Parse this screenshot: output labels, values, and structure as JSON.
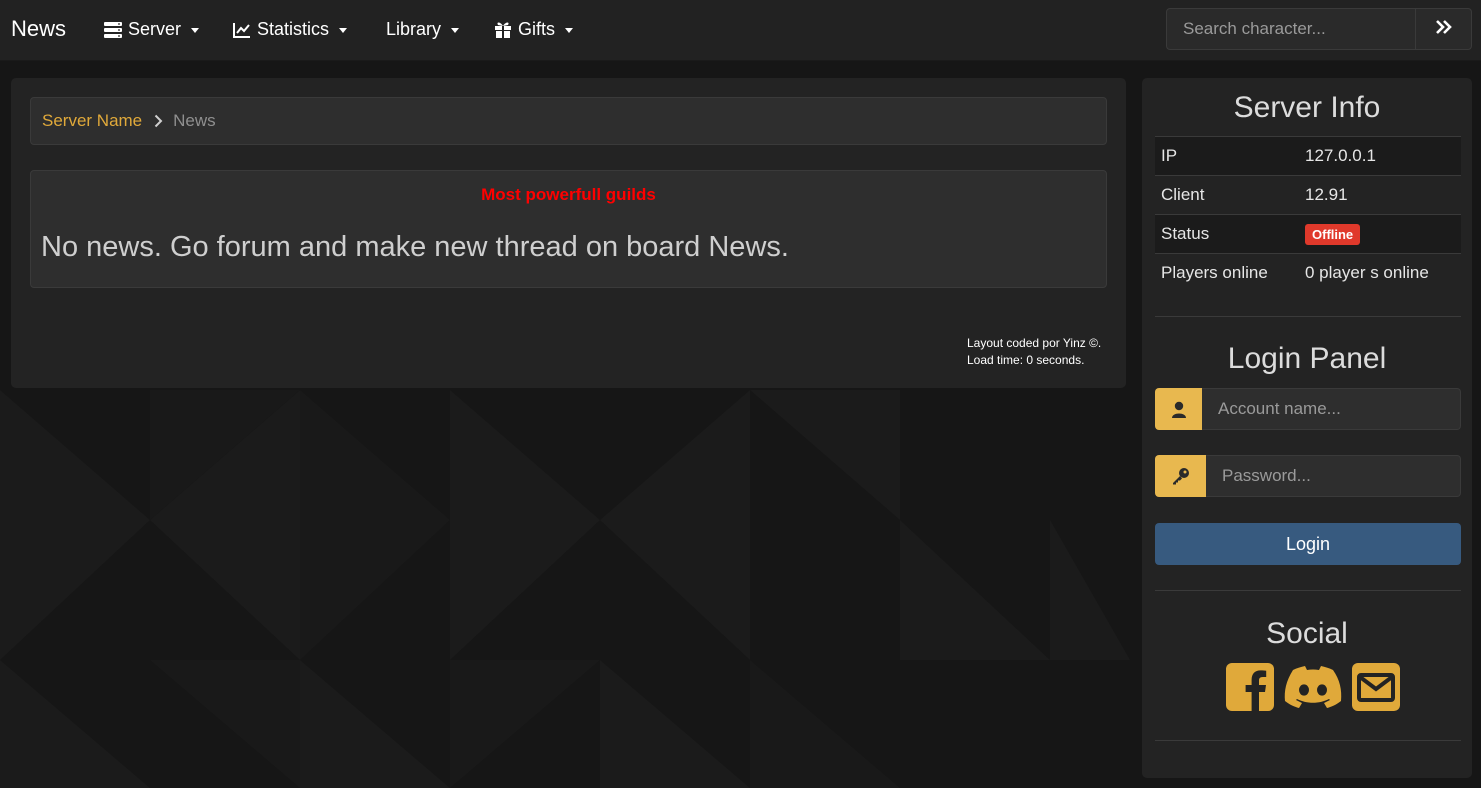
{
  "navbar": {
    "brand": "News",
    "items": [
      {
        "label": "Server",
        "icon": "server-icon"
      },
      {
        "label": "Statistics",
        "icon": "chart-icon"
      },
      {
        "label": "Library",
        "icon": ""
      },
      {
        "label": "Gifts",
        "icon": "gift-icon"
      }
    ],
    "search_placeholder": "Search character..."
  },
  "breadcrumb": {
    "home": "Server Name",
    "current": "News"
  },
  "news": {
    "guilds_title": "Most powerfull guilds",
    "message": "No news. Go forum and make new thread on board News."
  },
  "footer": {
    "credit": "Layout coded por Yinz ©.",
    "load_time": "Load time: 0 seconds."
  },
  "server_info": {
    "title": "Server Info",
    "rows": [
      {
        "key": "IP",
        "value": "127.0.0.1"
      },
      {
        "key": "Client",
        "value": "12.91"
      },
      {
        "key": "Status",
        "value": "Offline"
      },
      {
        "key": "Players online",
        "value": "0 player s online"
      }
    ]
  },
  "login_panel": {
    "title": "Login Panel",
    "account_placeholder": "Account name...",
    "password_placeholder": "Password...",
    "button": "Login"
  },
  "social": {
    "title": "Social",
    "icons": [
      "facebook-icon",
      "discord-icon",
      "envelope-icon"
    ]
  },
  "colors": {
    "accent": "#e8b84f",
    "link": "#e0a93a",
    "offline_badge": "#e0392b",
    "login_button": "#375a7f",
    "guilds_title": "#ff0000"
  }
}
